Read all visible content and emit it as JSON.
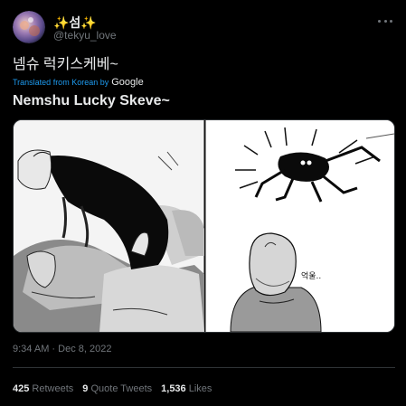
{
  "tweet": {
    "display_name": "✨섬✨",
    "handle": "@tekyu_love",
    "text": "넴슈 럭키스케베~",
    "translated_label": "Translated from Korean by",
    "translated_provider": "Google",
    "translation": "Nemshu Lucky Skeve~",
    "media": {
      "left_panel_alt": "manga panel: figure in black dress kneeling over a man lying on the floor",
      "right_panel_text": "억울.."
    },
    "timestamp": "9:34 AM · Dec 8, 2022",
    "stats": [
      {
        "count": "425",
        "label": "Retweets"
      },
      {
        "count": "9",
        "label": "Quote Tweets"
      },
      {
        "count": "1,536",
        "label": "Likes"
      }
    ]
  },
  "colors": {
    "background": "#000000",
    "text": "#e7e9ea",
    "muted": "#71767b",
    "link": "#1d9bf0",
    "divider": "#2f3336"
  },
  "icons": {
    "more": "more-horizontal-icon",
    "avatar": "avatar-image"
  }
}
